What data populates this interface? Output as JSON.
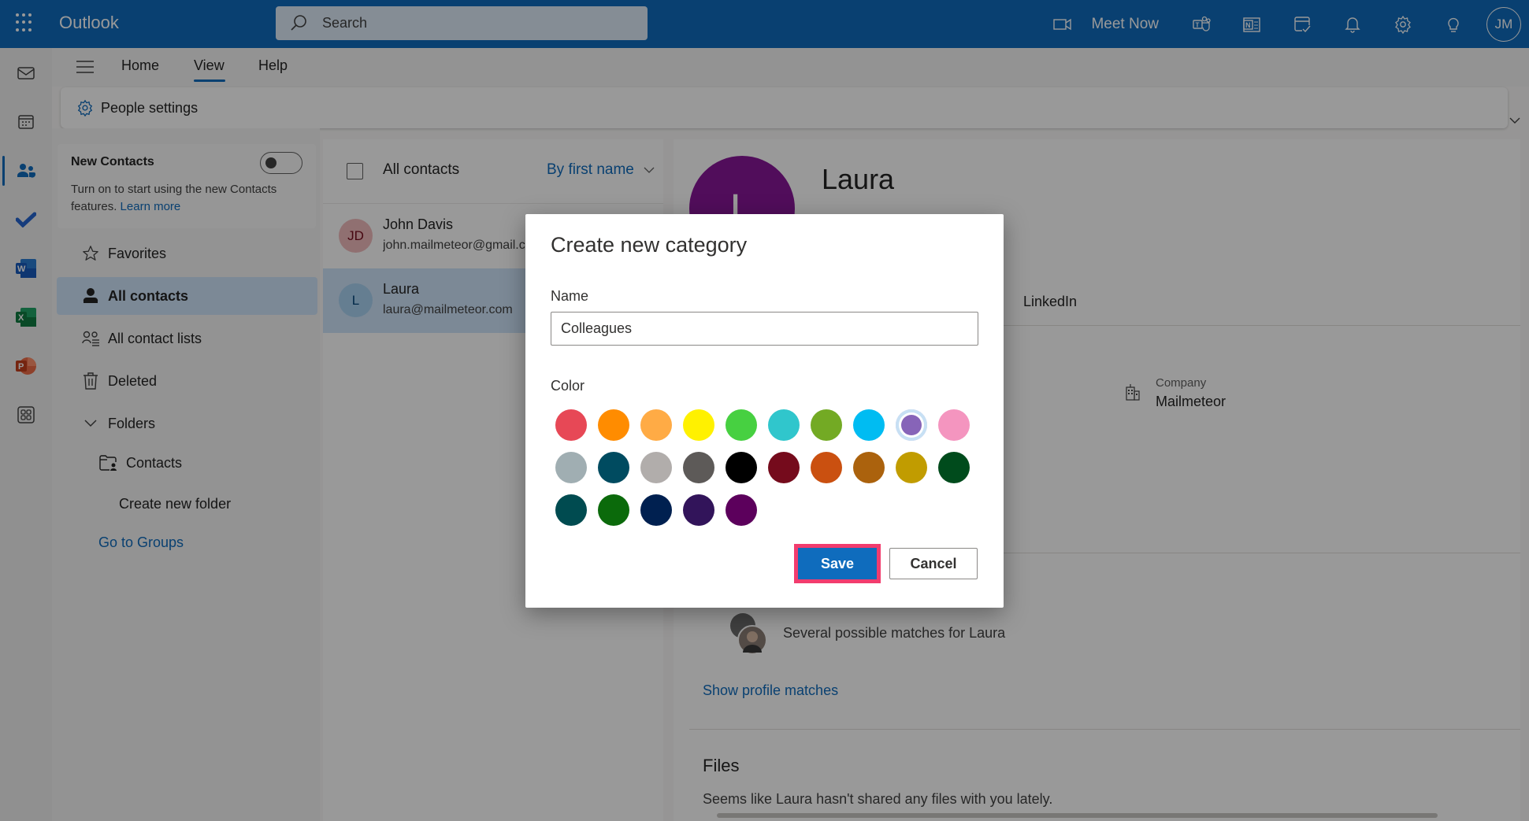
{
  "app": {
    "title": "Outlook",
    "search_placeholder": "Search",
    "meet_now": "Meet Now",
    "user_initials": "JM"
  },
  "topbar_icons": [
    "teams-icon",
    "onenote-icon",
    "my-day-icon",
    "bell-icon",
    "gear-icon",
    "lightbulb-icon"
  ],
  "rail": {
    "items": [
      {
        "name": "mail-icon"
      },
      {
        "name": "calendar-icon"
      },
      {
        "name": "people-icon",
        "selected": true
      },
      {
        "name": "todo-icon"
      },
      {
        "name": "word-icon"
      },
      {
        "name": "excel-icon"
      },
      {
        "name": "powerpoint-icon"
      },
      {
        "name": "more-apps-icon"
      }
    ]
  },
  "ribbon": {
    "tabs": [
      {
        "label": "Home"
      },
      {
        "label": "View",
        "active": true
      },
      {
        "label": "Help"
      }
    ],
    "people_settings": "People settings"
  },
  "nav": {
    "new_contacts": {
      "title": "New Contacts",
      "description": "Turn on to start using the new Contacts features.",
      "learn_more": "Learn more",
      "toggle_on": false
    },
    "items": [
      {
        "label": "Favorites",
        "icon": "star-icon"
      },
      {
        "label": "All contacts",
        "icon": "person-icon",
        "selected": true
      },
      {
        "label": "All contact lists",
        "icon": "contact-list-icon"
      },
      {
        "label": "Deleted",
        "icon": "trash-icon"
      }
    ],
    "folders_label": "Folders",
    "folder_contacts": "Contacts",
    "create_folder": "Create new folder",
    "go_to_groups": "Go to Groups"
  },
  "contact_list": {
    "title": "All contacts",
    "sort": "By first name",
    "contacts": [
      {
        "initials": "JD",
        "name": "John Davis",
        "email": "john.mailmeteor@gmail.com",
        "avatar_color": "#f1bbbc",
        "avatar_text": "#750b1c"
      },
      {
        "initials": "L",
        "name": "Laura",
        "email": "laura@mailmeteor.com",
        "avatar_color": "#a9d3f2",
        "avatar_text": "#004377",
        "selected": true
      }
    ]
  },
  "detail": {
    "initial": "L",
    "name": "Laura",
    "avatar_color": "#881798",
    "linkedin_tab": "LinkedIn",
    "company_label": "Company",
    "company_value": "Mailmeteor",
    "matches_text": "Several possible matches for Laura",
    "show_matches": "Show profile matches",
    "files_heading": "Files",
    "files_text": "Seems like Laura hasn't shared any files with you lately."
  },
  "dialog": {
    "title": "Create new category",
    "name_label": "Name",
    "name_value": "Colleagues",
    "color_label": "Color",
    "colors": [
      "#e74856",
      "#ff8c00",
      "#ffab45",
      "#fff100",
      "#47d041",
      "#30c6cc",
      "#73aa24",
      "#00bcf2",
      "#8764b8",
      "#f495bf",
      "#a0aeb2",
      "#004b60",
      "#b1adab",
      "#5d5a58",
      "#000000",
      "#750b1c",
      "#ca5010",
      "#ab620d",
      "#c19c00",
      "#004b1c",
      "#004b50",
      "#0b6a0b",
      "#002050",
      "#32145a",
      "#5c005c"
    ],
    "selected_color_index": 8,
    "save": "Save",
    "cancel": "Cancel"
  }
}
